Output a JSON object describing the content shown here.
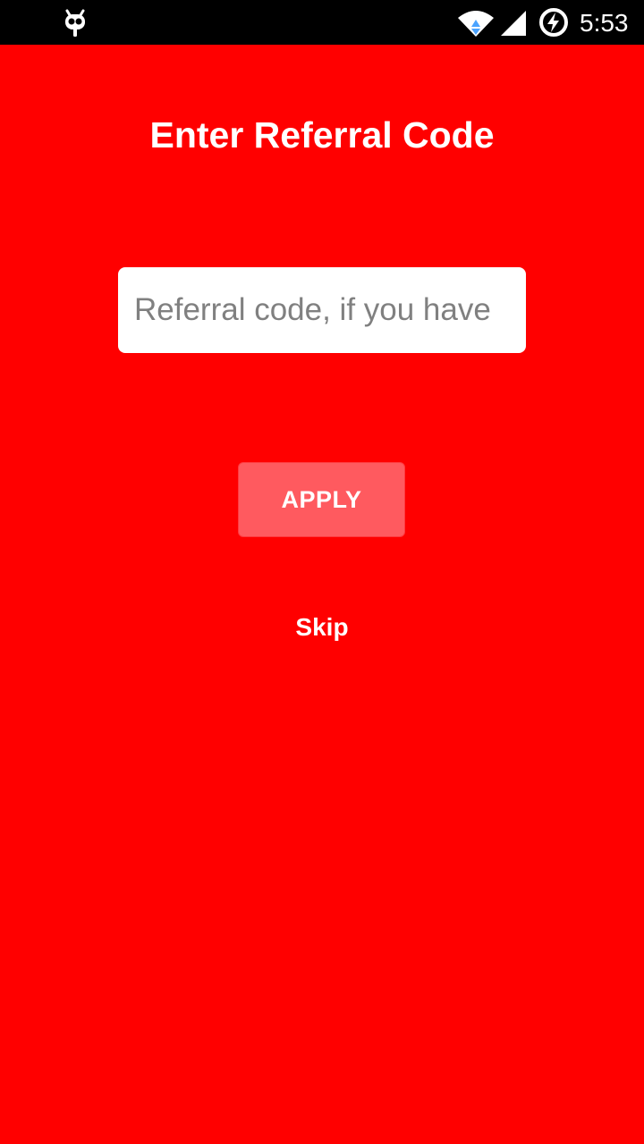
{
  "status_bar": {
    "time": "5:53",
    "icons": [
      "cyanogen-robot-icon",
      "wifi-icon",
      "signal-icon",
      "battery-charging-icon"
    ]
  },
  "colors": {
    "background": "#ff0000",
    "button": "#ff5a5f",
    "text": "#ffffff"
  },
  "screen": {
    "title": "Enter Referral Code",
    "referral_input": {
      "value": "",
      "placeholder": "Referral code, if you have"
    },
    "apply_label": "APPLY",
    "skip_label": "Skip"
  }
}
